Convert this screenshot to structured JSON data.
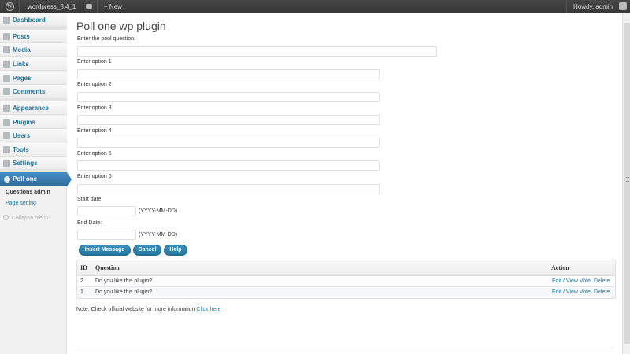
{
  "admin_bar": {
    "site_name": "wordpress_3.4_1",
    "new_label": "+ New",
    "howdy": "Howdy, admin"
  },
  "sidebar": {
    "items": [
      {
        "label": "Dashboard",
        "icon": "dashboard-icon"
      },
      {
        "label": "Posts",
        "icon": "posts-icon"
      },
      {
        "label": "Media",
        "icon": "media-icon"
      },
      {
        "label": "Links",
        "icon": "links-icon"
      },
      {
        "label": "Pages",
        "icon": "pages-icon"
      },
      {
        "label": "Comments",
        "icon": "comments-icon"
      },
      {
        "label": "Appearance",
        "icon": "appearance-icon"
      },
      {
        "label": "Plugins",
        "icon": "plugins-icon"
      },
      {
        "label": "Users",
        "icon": "users-icon"
      },
      {
        "label": "Tools",
        "icon": "tools-icon"
      },
      {
        "label": "Settings",
        "icon": "settings-icon"
      }
    ],
    "active_menu": {
      "label": "Poll one",
      "icon": "poll-icon"
    },
    "submenu": [
      "Questions admin",
      "Page setting"
    ],
    "collapse_label": "Collapse menu"
  },
  "page": {
    "title": "Poll one wp plugin",
    "question_label": "Enter the pool question:",
    "option_labels": [
      "Enter option 1",
      "Enter option 2",
      "Enter option 3",
      "Enter option 4",
      "Enter option 5",
      "Enter option 6"
    ],
    "start_date_label": "Start date",
    "end_date_label": "End Date:",
    "date_hint": "(YYYY-MM-DD)",
    "buttons": {
      "insert": "Insert Message",
      "cancel": "Cancel",
      "help": "Help"
    }
  },
  "table": {
    "headers": {
      "id": "ID",
      "question": "Question",
      "action": "Action"
    },
    "rows": [
      {
        "id": "2",
        "question": "Do you like this plugin?",
        "edit": "Edit / View Vote",
        "delete": "Delete"
      },
      {
        "id": "1",
        "question": "Do you like this plugin?",
        "edit": "Edit / View Vote",
        "delete": "Delete"
      }
    ]
  },
  "note": {
    "text": "Note: Check official website for more information",
    "link": "Click here"
  },
  "colors": {
    "accent": "#21759b",
    "admin_bar": "#464646",
    "active_menu": "#2e6a9e"
  }
}
